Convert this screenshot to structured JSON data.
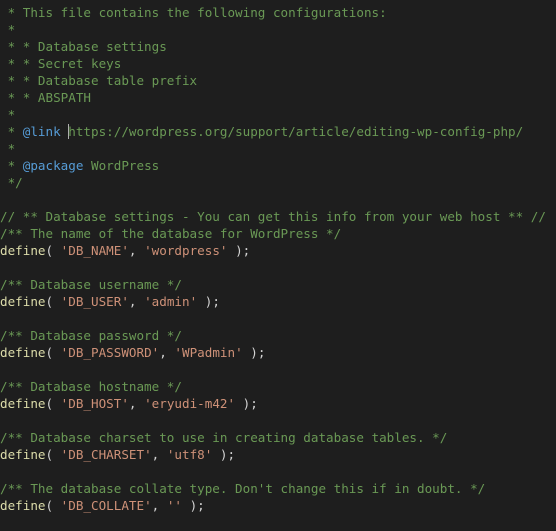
{
  "editor": {
    "lines": [
      [
        {
          "t": " * This file contains the following configurations:",
          "k": "c-comment"
        }
      ],
      [
        {
          "t": " *",
          "k": "c-comment"
        }
      ],
      [
        {
          "t": " * * Database settings",
          "k": "c-comment"
        }
      ],
      [
        {
          "t": " * * Secret keys",
          "k": "c-comment"
        }
      ],
      [
        {
          "t": " * * Database table prefix",
          "k": "c-comment"
        }
      ],
      [
        {
          "t": " * * ABSPATH",
          "k": "c-comment"
        }
      ],
      [
        {
          "t": " *",
          "k": "c-comment"
        }
      ],
      [
        {
          "t": " * ",
          "k": "c-comment"
        },
        {
          "t": "@link",
          "k": "c-doc-tag"
        },
        {
          "t": " ",
          "k": "c-comment"
        },
        {
          "cursor": true
        },
        {
          "t": "https://wordpress.org/support/article/editing-wp-config-php/",
          "k": "c-doc-text"
        }
      ],
      [
        {
          "t": " *",
          "k": "c-comment"
        }
      ],
      [
        {
          "t": " * ",
          "k": "c-comment"
        },
        {
          "t": "@package",
          "k": "c-doc-tag"
        },
        {
          "t": " WordPress",
          "k": "c-doc-text"
        }
      ],
      [
        {
          "t": " */",
          "k": "c-comment"
        }
      ],
      [],
      [
        {
          "t": "// ** Database settings - You can get this info from your web host ** //",
          "k": "c-comment"
        }
      ],
      [
        {
          "t": "/** The name of the database for WordPress */",
          "k": "c-comment"
        }
      ],
      [
        {
          "t": "define",
          "k": "c-keyword"
        },
        {
          "t": "( ",
          "k": "c-punct"
        },
        {
          "t": "'DB_NAME'",
          "k": "c-string"
        },
        {
          "t": ", ",
          "k": "c-punct"
        },
        {
          "t": "'wordpress'",
          "k": "c-string"
        },
        {
          "t": " );",
          "k": "c-punct"
        }
      ],
      [],
      [
        {
          "t": "/** Database username */",
          "k": "c-comment"
        }
      ],
      [
        {
          "t": "define",
          "k": "c-keyword"
        },
        {
          "t": "( ",
          "k": "c-punct"
        },
        {
          "t": "'DB_USER'",
          "k": "c-string"
        },
        {
          "t": ", ",
          "k": "c-punct"
        },
        {
          "t": "'admin'",
          "k": "c-string"
        },
        {
          "t": " );",
          "k": "c-punct"
        }
      ],
      [],
      [
        {
          "t": "/** Database password */",
          "k": "c-comment"
        }
      ],
      [
        {
          "t": "define",
          "k": "c-keyword"
        },
        {
          "t": "( ",
          "k": "c-punct"
        },
        {
          "t": "'DB_PASSWORD'",
          "k": "c-string"
        },
        {
          "t": ", ",
          "k": "c-punct"
        },
        {
          "t": "'WPadmin'",
          "k": "c-string"
        },
        {
          "t": " );",
          "k": "c-punct"
        }
      ],
      [],
      [
        {
          "t": "/** Database hostname */",
          "k": "c-comment"
        }
      ],
      [
        {
          "t": "define",
          "k": "c-keyword"
        },
        {
          "t": "( ",
          "k": "c-punct"
        },
        {
          "t": "'DB_HOST'",
          "k": "c-string"
        },
        {
          "t": ", ",
          "k": "c-punct"
        },
        {
          "t": "'eryudi-m42'",
          "k": "c-string"
        },
        {
          "t": " );",
          "k": "c-punct"
        }
      ],
      [],
      [
        {
          "t": "/** Database charset to use in creating database tables. */",
          "k": "c-comment"
        }
      ],
      [
        {
          "t": "define",
          "k": "c-keyword"
        },
        {
          "t": "( ",
          "k": "c-punct"
        },
        {
          "t": "'DB_CHARSET'",
          "k": "c-string"
        },
        {
          "t": ", ",
          "k": "c-punct"
        },
        {
          "t": "'utf8'",
          "k": "c-string"
        },
        {
          "t": " );",
          "k": "c-punct"
        }
      ],
      [],
      [
        {
          "t": "/** The database collate type. Don't change this if in doubt. */",
          "k": "c-comment"
        }
      ],
      [
        {
          "t": "define",
          "k": "c-keyword"
        },
        {
          "t": "( ",
          "k": "c-punct"
        },
        {
          "t": "'DB_COLLATE'",
          "k": "c-string"
        },
        {
          "t": ", ",
          "k": "c-punct"
        },
        {
          "t": "''",
          "k": "c-string"
        },
        {
          "t": " );",
          "k": "c-punct"
        }
      ]
    ]
  },
  "colors": {
    "background": "#1e1e1e",
    "comment": "#6a9955",
    "doc_tag": "#569cd6",
    "function": "#dcdcaa",
    "string": "#ce9178",
    "punctuation": "#d4d4d4"
  }
}
